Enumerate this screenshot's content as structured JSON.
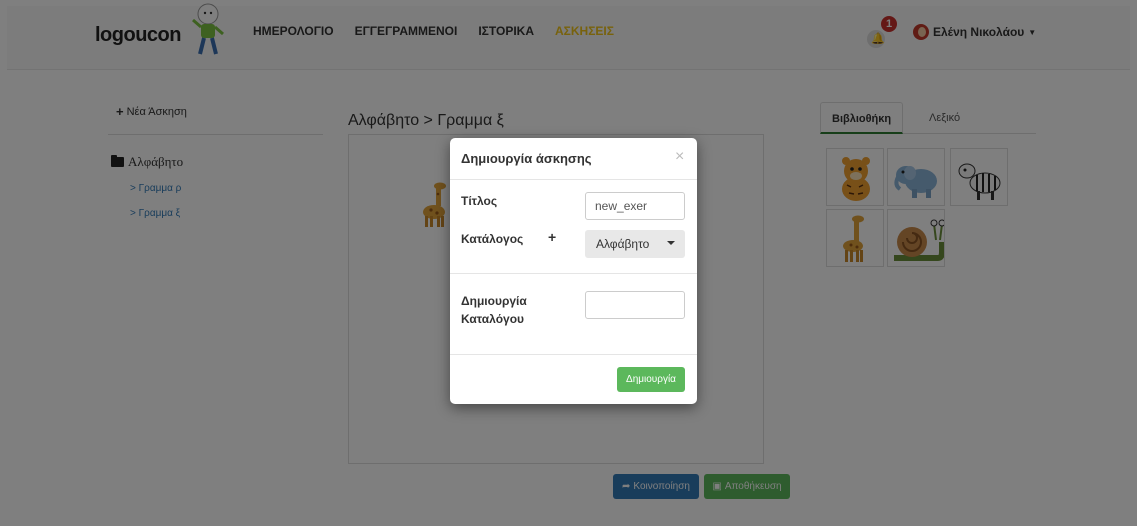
{
  "navbar": {
    "brand": "logoucon",
    "items": [
      {
        "label": "ΗΜΕΡΟΛΟΓΙΟ"
      },
      {
        "label": "ΕΓΓΕΓΡΑΜΜΕΝΟΙ"
      },
      {
        "label": "ΙΣΤΟΡΙΚΑ"
      },
      {
        "label": "ΑΣΚΗΣΕΙΣ",
        "active": true
      }
    ],
    "notification_count": "1",
    "user_name": "Ελένη Νικολάου"
  },
  "sidebar": {
    "new_exercise": "Νέα Άσκηση",
    "folder": "Αλφάβητο",
    "items": [
      {
        "label": "> Γραμμα ρ"
      },
      {
        "label": "> Γραμμα ξ"
      }
    ]
  },
  "main": {
    "breadcrumb": "Αλφάβητο > Γραμμα ξ",
    "share_button": "Κοινοποίηση",
    "save_button": "Αποθήκευση"
  },
  "library": {
    "tabs": [
      {
        "label": "Βιβλιοθήκη",
        "active": true
      },
      {
        "label": "Λεξικό"
      }
    ],
    "images": [
      "tiger",
      "elephant",
      "zebra",
      "giraffe",
      "snail"
    ]
  },
  "modal": {
    "title": "Δημιουργία άσκησης",
    "close": "×",
    "title_label": "Τίτλος",
    "title_value": "new_exer",
    "catalog_label": "Κατάλογος",
    "catalog_add": "+",
    "catalog_value": "Αλφάβητο",
    "create_catalog_label_1": "Δημιουργία",
    "create_catalog_label_2": "Καταλόγου",
    "create_catalog_value": "",
    "create_button": "Δημιουργία"
  },
  "colors": {
    "active_nav": "#f0c419",
    "primary": "#337ab7",
    "success": "#5cb85c",
    "badge": "#c9302c",
    "tab_underline": "#2e7d32"
  }
}
